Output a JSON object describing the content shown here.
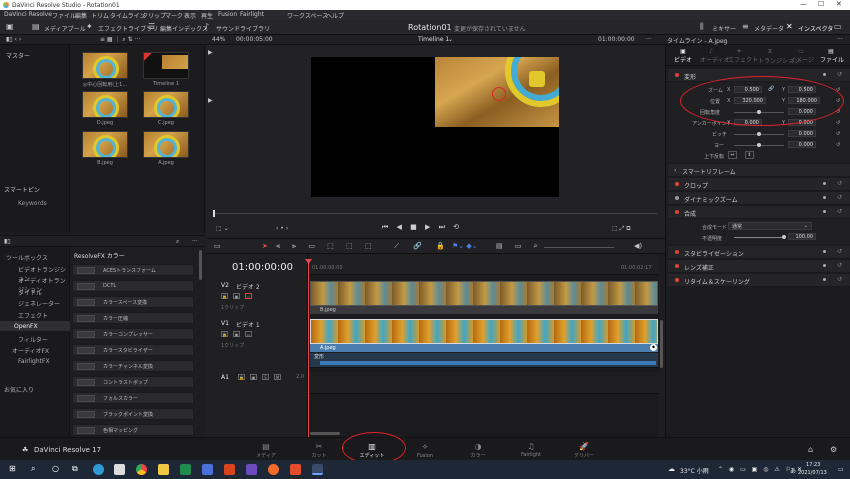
{
  "window": {
    "title": "DaVinci Resolve Studio - Rotation01"
  },
  "menu": [
    "DaVinci Resolve",
    "ファイル",
    "編集",
    "トリム",
    "タイムライン",
    "クリップ",
    "マーク",
    "表示",
    "再生",
    "Fusion",
    "Fairlight",
    "ワークスペース",
    "ヘルプ"
  ],
  "toolbar": {
    "left": [
      "メディアプール",
      "エフェクトライブラリ",
      "編集インデックス",
      "サウンドライブラリ"
    ],
    "project_title": "Rotation01",
    "save_status": "変更が保存されていません",
    "right": [
      "ミキサー",
      "メタデータ",
      "インスペクタ"
    ]
  },
  "subbar": {
    "zoom": "44%",
    "source_tc": "00:00:05:00",
    "timeline_name": "Timeline 1",
    "record_tc": "01:00:00:00",
    "inspector_title": "タイムライン - A.jpeg"
  },
  "media_pool": {
    "bin_root": "マスター",
    "clips": [
      {
        "name": "◎中心回転用(上1...",
        "type": "image"
      },
      {
        "name": "Timeline 1",
        "type": "timeline"
      },
      {
        "name": "D.jpeg",
        "type": "image"
      },
      {
        "name": "C.jpeg",
        "type": "image"
      },
      {
        "name": "B.jpeg",
        "type": "image"
      },
      {
        "name": "A.jpeg",
        "type": "image"
      }
    ],
    "smart_bins": "スマートビン",
    "keywords": "Keywords"
  },
  "effects": {
    "tree": [
      "ツールボックス",
      "ビデオトランジション",
      "オーディオトランジション",
      "タイトル",
      "ジェネレーター",
      "エフェクト",
      "OpenFX",
      "フィルター",
      "オーディオFX",
      "FairlightFX",
      "お気に入り"
    ],
    "category": "ResolveFX カラー",
    "items": [
      "ACESトランスフォーム",
      "DCTL",
      "カラースペース変換",
      "カラー圧縮",
      "カラーコンプレッサー",
      "カラースタビライザー",
      "カラーチャンネル変換",
      "コントラストポップ",
      "フォルスカラー",
      "ブラックポイント変換",
      "色相マッピング"
    ]
  },
  "viewer": {
    "playhead_tc": "01:00:00:00"
  },
  "timeline": {
    "timecode": "01:00:00:00",
    "ruler_marks": [
      "01:00:00:00",
      "01:00:02:17"
    ],
    "tracks": [
      {
        "id": "V2",
        "name": "ビデオ 2",
        "clips": "1クリップ",
        "clip_name": "B.jpeg"
      },
      {
        "id": "V1",
        "name": "ビデオ 1",
        "clips": "1クリップ",
        "clip_name": "A.jpeg",
        "keyframe_label": "変形"
      },
      {
        "id": "A1",
        "name": "",
        "level": "2.0"
      }
    ]
  },
  "inspector": {
    "tabs": [
      "ビデオ",
      "オーディオ",
      "エフェクト",
      "トランジション",
      "イメージ",
      "ファイル"
    ],
    "transform": {
      "header": "変形",
      "zoom_label": "ズーム",
      "zoom_x": "0.500",
      "zoom_y": "0.500",
      "position_label": "位置",
      "position_x": "320.000",
      "position_y": "180.000",
      "rotation_label": "回転角度",
      "rotation_value": "0.000",
      "anchor_label": "アンカーポイント",
      "anchor_x": "0.000",
      "anchor_y": "0.000",
      "pitch_label": "ピッチ",
      "pitch_value": "0.000",
      "yaw_label": "ヨー",
      "yaw_value": "0.000",
      "flip_label": "上下反転"
    },
    "sections": [
      "スマートリフレーム",
      "クロップ",
      "ダイナミックズーム",
      "合成",
      "スタビライゼーション",
      "レンズ補正",
      "リタイム＆スケーリング"
    ],
    "composite": {
      "mode_label": "合成モード",
      "mode_value": "通常",
      "opacity_label": "不透明度",
      "opacity_value": "100.00"
    }
  },
  "pages": [
    "メディア",
    "カット",
    "エディット",
    "Fusion",
    "カラー",
    "Fairlight",
    "デリバー"
  ],
  "app_brand": "DaVinci Resolve 17",
  "taskbar": {
    "weather": "33°C 小雨",
    "ime": "あ",
    "time": "17:23",
    "date": "2021/07/13"
  },
  "accent": "#e5484d"
}
